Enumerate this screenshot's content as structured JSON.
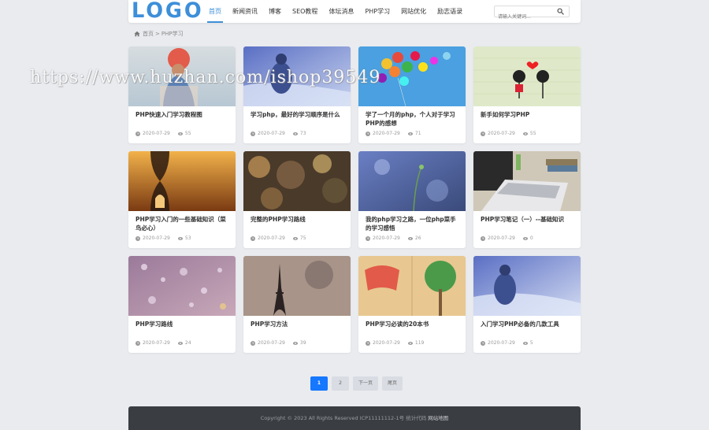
{
  "header": {
    "logo": "LOGO",
    "nav": [
      "首页",
      "新闻资讯",
      "博客",
      "SEO教程",
      "体坛消息",
      "PHP学习",
      "网站优化",
      "励志语录"
    ],
    "search_placeholder": "请输入关键词..."
  },
  "breadcrumb": {
    "home": "首页",
    "separator": ">",
    "current": "PHP学习"
  },
  "cards": [
    {
      "title": "PHP快速入门学习教程图",
      "date": "2020-07-29",
      "views": "55",
      "thumb": "girl-balloon"
    },
    {
      "title": "学习php，最好的学习顺序是什么",
      "date": "2020-07-29",
      "views": "73",
      "thumb": "girl-sea"
    },
    {
      "title": "学了一个月的php，个人对于学习PHP的感想",
      "date": "2020-07-29",
      "views": "71",
      "thumb": "balloons-sky"
    },
    {
      "title": "新手如何学习PHP",
      "date": "2020-07-29",
      "views": "55",
      "thumb": "couple-drawing"
    },
    {
      "title": "PHP学习入门的一些基础知识（菜鸟必心）",
      "date": "2020-07-29",
      "views": "53",
      "thumb": "hourglass"
    },
    {
      "title": "完整的PHP学习路线",
      "date": "2020-07-29",
      "views": "75",
      "thumb": "bokeh"
    },
    {
      "title": "我的php学习之路，一位php菜手的学习感悟",
      "date": "2020-07-29",
      "views": "26",
      "thumb": "plant-bokeh"
    },
    {
      "title": "PHP学习笔记（一）--基础知识",
      "date": "2020-07-29",
      "views": "0",
      "thumb": "laptop-books"
    },
    {
      "title": "PHP学习路线",
      "date": "2020-07-29",
      "views": "24",
      "thumb": "rain-glass"
    },
    {
      "title": "PHP学习方法",
      "date": "2020-07-29",
      "views": "39",
      "thumb": "eiffel"
    },
    {
      "title": "PHP学习必读的20本书",
      "date": "2020-07-29",
      "views": "119",
      "thumb": "book-tree"
    },
    {
      "title": "入门学习PHP必备的几款工具",
      "date": "2020-07-29",
      "views": "5",
      "thumb": "girl-sea-2"
    }
  ],
  "pager": {
    "page1": "1",
    "page2": "2",
    "next": "下一页",
    "last": "尾页"
  },
  "footer": {
    "copyright": "Copyright © 2023 All Rights Reserved ICP11111112-1号 统计代码",
    "sitemap": "网站地图"
  },
  "watermark": "https://www.huzhan.com/ishop39549",
  "colors": {
    "accent": "#3d8fd9",
    "page_current": "#1677ff",
    "footer_bg": "#3a3d42",
    "background": "#e9ebef"
  }
}
